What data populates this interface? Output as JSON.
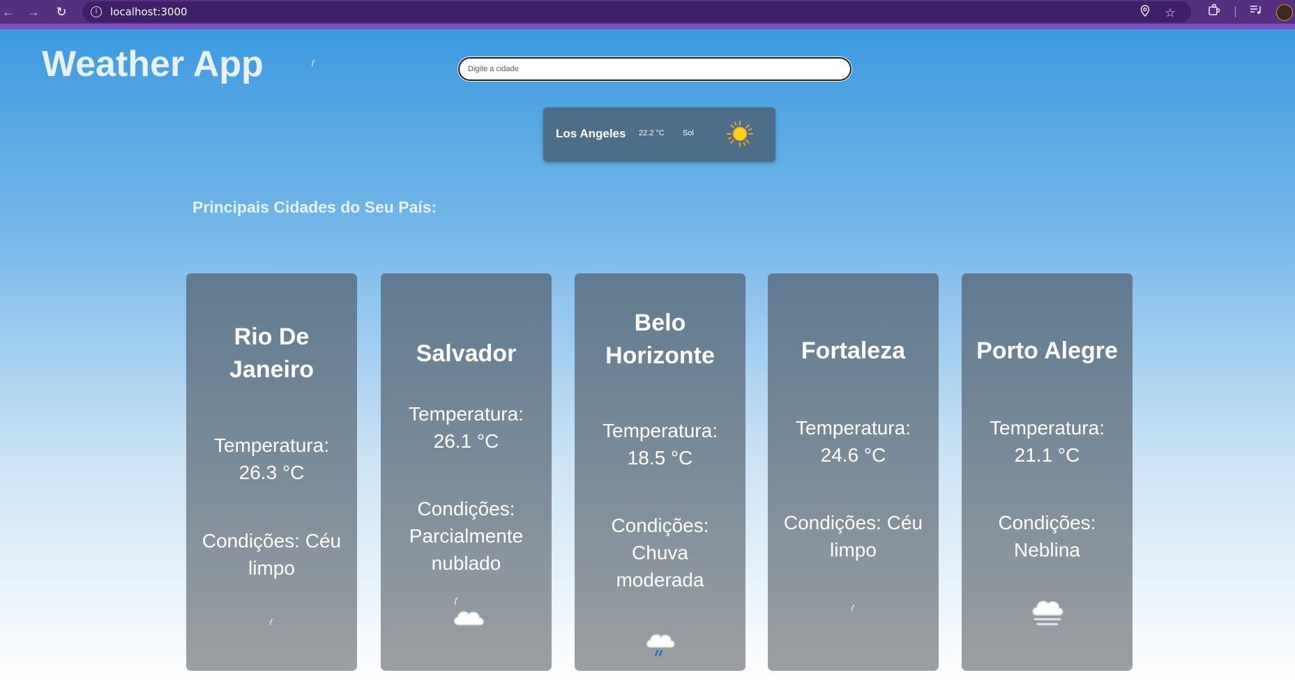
{
  "browser": {
    "url": "localhost:3000"
  },
  "app": {
    "title": "Weather App",
    "theme_icon": "moon-icon"
  },
  "search": {
    "placeholder": "Digite a cidade"
  },
  "current": {
    "city": "Los Angeles",
    "temperature": "22.2 °C",
    "condition": "Sol",
    "icon": "sun-icon"
  },
  "section": {
    "title": "Principais Cidades do Seu País:"
  },
  "cities": [
    {
      "name_lines": [
        "Rio De",
        "Janeiro"
      ],
      "temp_lines": [
        "Temperatura:",
        "26.3 °C"
      ],
      "cond_lines": [
        "Condições: Céu",
        "limpo"
      ],
      "icon": "moon-icon"
    },
    {
      "name_lines": [
        "Salvador"
      ],
      "temp_lines": [
        "Temperatura:",
        "26.1 °C"
      ],
      "cond_lines": [
        "Condições:",
        "Parcialmente",
        "nublado"
      ],
      "icon": "moon-cloud-icon"
    },
    {
      "name_lines": [
        "Belo",
        "Horizonte"
      ],
      "temp_lines": [
        "Temperatura:",
        "18.5 °C"
      ],
      "cond_lines": [
        "Condições:",
        "Chuva",
        "moderada"
      ],
      "icon": "rain-cloud-icon"
    },
    {
      "name_lines": [
        "Fortaleza"
      ],
      "temp_lines": [
        "Temperatura:",
        "24.6 °C"
      ],
      "cond_lines": [
        "Condições: Céu",
        "limpo"
      ],
      "icon": "moon-icon"
    },
    {
      "name_lines": [
        "Porto Alegre"
      ],
      "temp_lines": [
        "Temperatura:",
        "21.1 °C"
      ],
      "cond_lines": [
        "Condições:",
        "Neblina"
      ],
      "icon": "fog-icon"
    }
  ],
  "colors": {
    "browser_bar": "#56307e",
    "card_top": "#5f7b91",
    "card_bottom": "#9c9fa2",
    "current_card": "#4d6e8a",
    "moon": "#1f6fd1"
  }
}
